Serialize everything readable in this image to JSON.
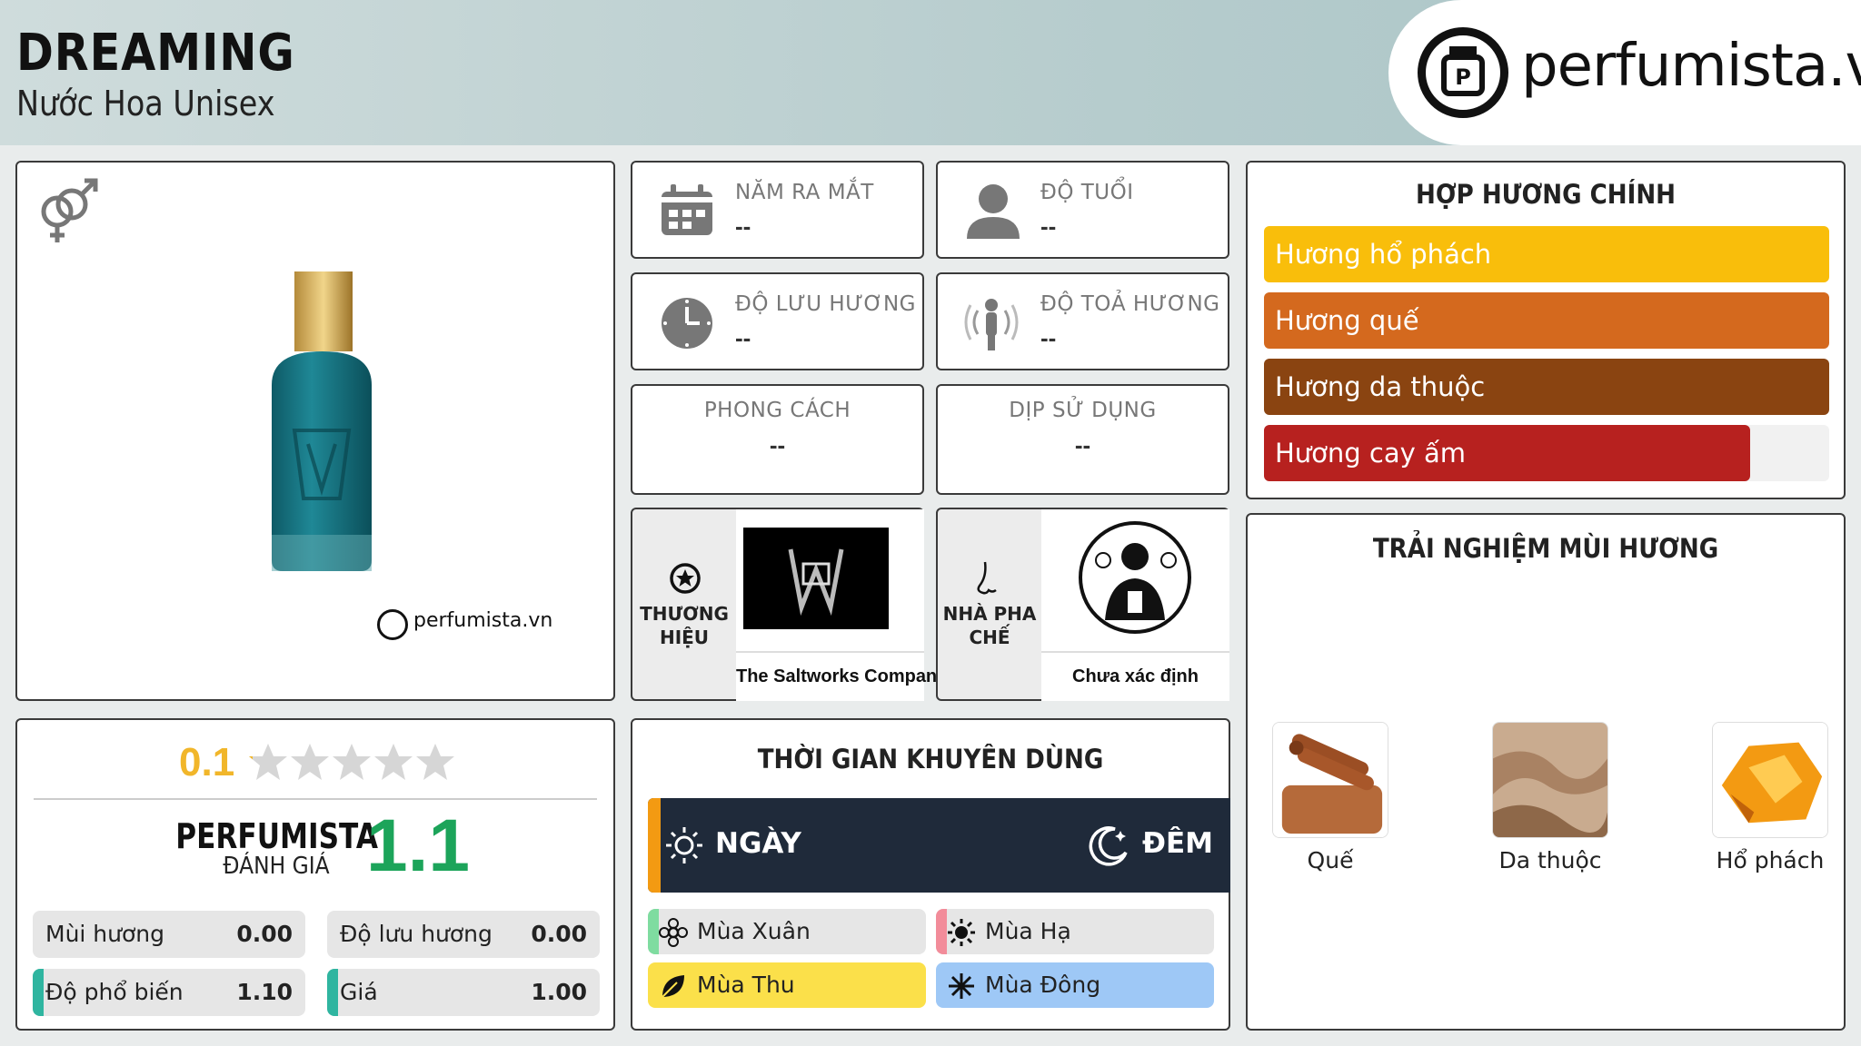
{
  "header": {
    "title": "DREAMING",
    "subtitle": "Nước Hoa Unisex",
    "logo_text": "perfumista.vn"
  },
  "product": {
    "watermark": "perfumista.vn"
  },
  "stats": {
    "launch_year": {
      "label": "NĂM RA MẮT",
      "value": "--"
    },
    "age": {
      "label": "ĐỘ TUỔI",
      "value": "--"
    },
    "longevity": {
      "label": "ĐỘ LƯU HƯƠNG",
      "value": "--"
    },
    "sillage": {
      "label": "ĐỘ TOẢ HƯƠNG",
      "value": "--"
    },
    "style": {
      "label": "PHONG CÁCH",
      "value": "--"
    },
    "occasion": {
      "label": "DỊP SỬ DỤNG",
      "value": "--"
    }
  },
  "brand": {
    "label_line1": "THƯƠNG",
    "label_line2": "HIỆU",
    "name": "The Saltworks Company"
  },
  "perfumer": {
    "label_line1": "NHÀ PHA",
    "label_line2": "CHẾ",
    "name": "Chưa xác định"
  },
  "accords": {
    "title": "HỢP HƯƠNG CHÍNH",
    "items": [
      {
        "label": "Hương hổ phách",
        "color": "#f9be0b",
        "fraction": 1.0
      },
      {
        "label": "Hương quế",
        "color": "#d4691e",
        "fraction": 1.0
      },
      {
        "label": "Hương da thuộc",
        "color": "#8a4411",
        "fraction": 1.0
      },
      {
        "label": "Hương cay ấm",
        "color": "#b7211f",
        "fraction": 0.86
      }
    ]
  },
  "experience": {
    "title": "TRẢI NGHIỆM MÙI HƯƠNG",
    "items": [
      {
        "label": "Quế"
      },
      {
        "label": "Da thuộc"
      },
      {
        "label": "Hổ phách"
      }
    ]
  },
  "rating": {
    "user_score": "0.1",
    "stars_filled": 0.02,
    "brand_label": "PERFUMISTA",
    "review_label": "ĐÁNH GIÁ",
    "score": "1.1",
    "metrics": [
      {
        "label": "Mùi hương",
        "value": "0.00"
      },
      {
        "label": "Độ lưu hương",
        "value": "0.00"
      },
      {
        "label": "Độ phổ biến",
        "value": "1.10"
      },
      {
        "label": "Giá",
        "value": "1.00"
      }
    ]
  },
  "usage": {
    "title": "THỜI GIAN KHUYÊN DÙNG",
    "day": "NGÀY",
    "night": "ĐÊM",
    "seasons": [
      {
        "label": "Mùa Xuân",
        "color": "#e6e6e6"
      },
      {
        "label": "Mùa Hạ",
        "color": "#e6e6e6"
      },
      {
        "label": "Mùa Thu",
        "color": "#fbe04a"
      },
      {
        "label": "Mùa Đông",
        "color": "#9ec8f6"
      }
    ]
  }
}
